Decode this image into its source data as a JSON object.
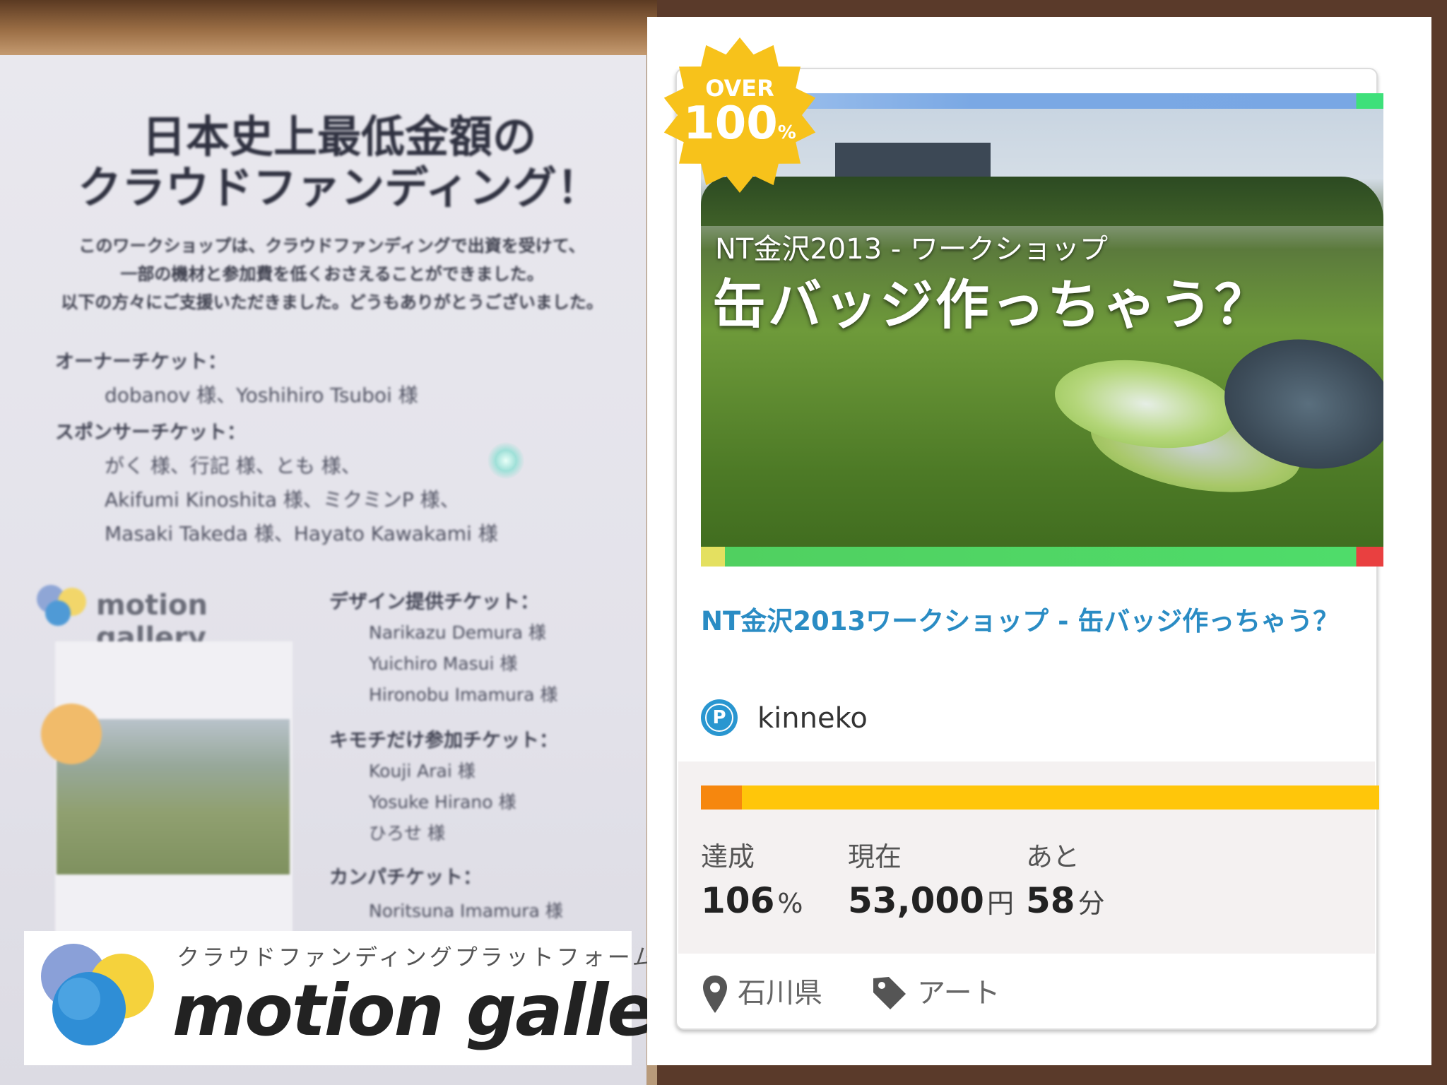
{
  "poster": {
    "title": "日本史上最低金額の\nクラウドファンディング！",
    "intro": "このワークショップは、クラウドファンディングで出資を受けて、\n一部の機材と参加費を低くおさえることができました。\n以下の方々にご支援いただきました。どうもありがとうございました。",
    "sections": [
      {
        "heading": "オーナーチケット：",
        "lines": [
          "dobanov 様、Yoshihiro Tsuboi 様"
        ]
      },
      {
        "heading": "スポンサーチケット：",
        "lines": [
          "がく 様、行記 様、とも 様、",
          "Akifumi Kinoshita 様、ミクミンP 様、",
          "Masaki Takeda 様、Hayato Kawakami 様"
        ]
      }
    ],
    "right_sections": [
      {
        "heading": "デザイン提供チケット：",
        "lines": [
          "Narikazu Demura 様",
          "Yuichiro Masui 様",
          "Hironobu Imamura 様"
        ]
      },
      {
        "heading": "キモチだけ参加チケット：",
        "lines": [
          "Kouji Arai 様",
          "Yosuke Hirano 様",
          "ひろせ 様"
        ]
      },
      {
        "heading": "カンパチケット：",
        "lines": [
          "Noritsuna Imamura 様"
        ]
      }
    ],
    "logo_text": "motion gallery"
  },
  "banner": {
    "tagline": "クラウドファンディングプラットフォーム",
    "name": "motion gallery"
  },
  "card": {
    "badge_over": "OVER",
    "badge_percent": "100",
    "badge_percent_unit": "%",
    "image_subtitle": "NT金沢2013 - ワークショップ",
    "image_title": "缶バッジ作っちゃう？",
    "title": "NT金沢2013ワークショップ - 缶バッジ作っちゃう？",
    "owner": {
      "icon_letter": "P",
      "name": "kinneko"
    },
    "progress_overflow_fraction": 0.06,
    "stats": [
      {
        "label": "達成",
        "value": "106",
        "unit": "%"
      },
      {
        "label": "現在",
        "value": "53,000",
        "unit": "円"
      },
      {
        "label": "あと",
        "value": "58",
        "unit": "分"
      }
    ],
    "location": "石川県",
    "category": "アート"
  },
  "colors": {
    "title_blue": "#2a8cc4",
    "progress_yellow": "#ffc60a",
    "progress_orange": "#f6870e",
    "badge_yellow": "#f7c21b"
  }
}
